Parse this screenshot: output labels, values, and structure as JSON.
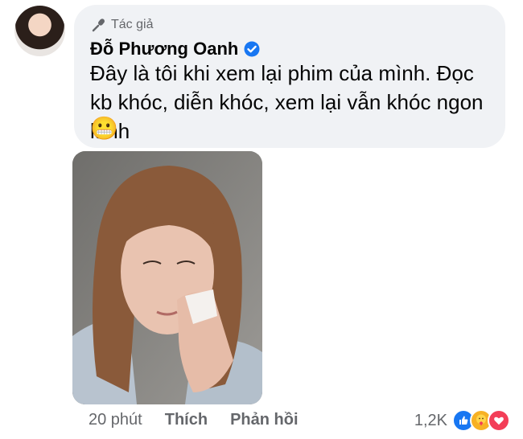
{
  "comment": {
    "author_tag": "Tác giả",
    "author_name": "Đỗ Phương Oanh",
    "text": "Đây là tôi khi xem lại phim của mình. Đọc kb khóc, diễn khóc, xem lại vẫn khóc ngon lành",
    "emoji": "😬"
  },
  "footer": {
    "time": "20 phút",
    "like_label": "Thích",
    "reply_label": "Phản hồi",
    "reaction_count": "1,2K"
  },
  "icons": {
    "author_tag": "microphone-icon",
    "verified": "verified-badge-icon",
    "reactions": [
      "like-reaction-icon",
      "care-reaction-icon",
      "love-reaction-icon"
    ]
  },
  "colors": {
    "bubble_bg": "#f0f2f5",
    "secondary_text": "#65676b",
    "verified_blue": "#1877f2",
    "love_red": "#f33e58",
    "care_yellow": "#f7b125"
  }
}
